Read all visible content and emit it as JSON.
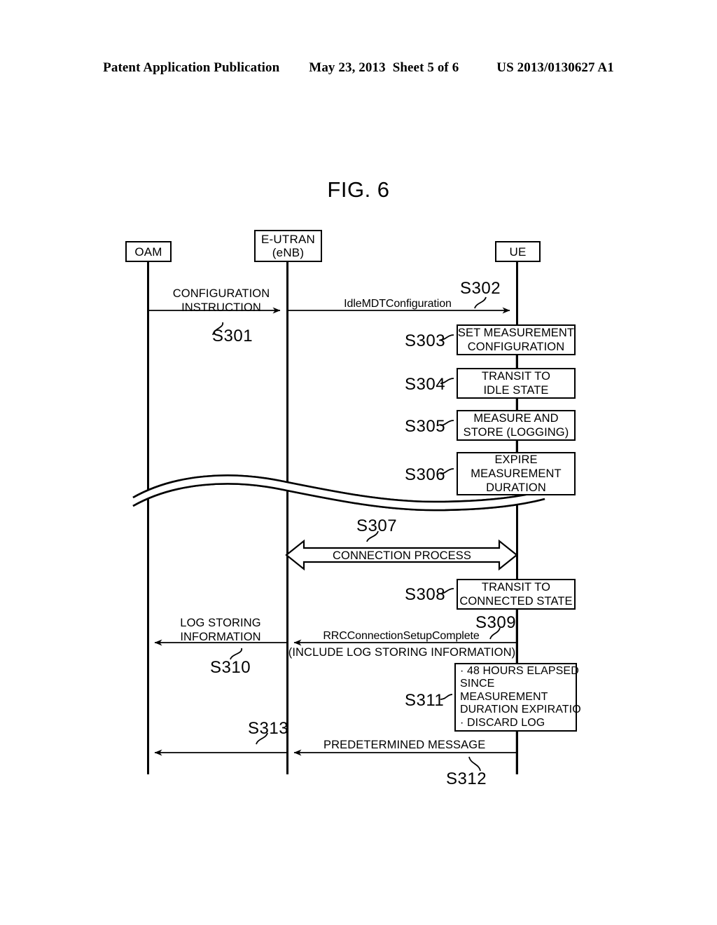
{
  "header": {
    "publication": "Patent Application Publication",
    "date": "May 23, 2013",
    "sheet": "Sheet 5 of 6",
    "patent_number": "US 2013/0130627 A1"
  },
  "figure": {
    "title": "FIG. 6"
  },
  "participants": [
    {
      "id": "oam",
      "label": "OAM"
    },
    {
      "id": "enb",
      "label_line1": "E-UTRAN",
      "label_line2": "(eNB)"
    },
    {
      "id": "ue",
      "label": "UE"
    }
  ],
  "messages": [
    {
      "step": "S301",
      "from": "oam",
      "to": "enb",
      "label_line1": "CONFIGURATION",
      "label_line2": "INSTRUCTION",
      "direction": "right"
    },
    {
      "step": "S302",
      "from": "enb",
      "to": "ue",
      "label_line1": "IdleMDTConfiguration",
      "direction": "right"
    },
    {
      "step": "S307",
      "from": "enb",
      "to": "ue",
      "label_line1": "CONNECTION PROCESS",
      "direction": "bidirectional"
    },
    {
      "step": "S309",
      "from": "ue",
      "to": "enb",
      "label_line1": "RRCConnectionSetupComplete",
      "label_line2": "(INCLUDE LOG STORING INFORMATION)",
      "direction": "left"
    },
    {
      "step": "S310",
      "from": "enb",
      "to": "oam",
      "label_line1": "LOG STORING",
      "label_line2": "INFORMATION",
      "direction": "left"
    },
    {
      "step": "S312",
      "from": "ue",
      "to": "enb",
      "label_line1": "PREDETERMINED MESSAGE",
      "direction": "left"
    },
    {
      "step": "S313",
      "from": "enb",
      "to": "oam",
      "label_line1": "",
      "direction": "left"
    }
  ],
  "process_boxes": [
    {
      "step": "S303",
      "on": "ue",
      "lines": [
        "SET MEASUREMENT",
        "CONFIGURATION"
      ]
    },
    {
      "step": "S304",
      "on": "ue",
      "lines": [
        "TRANSIT TO",
        "IDLE STATE"
      ]
    },
    {
      "step": "S305",
      "on": "ue",
      "lines": [
        "MEASURE AND",
        "STORE (LOGGING)"
      ]
    },
    {
      "step": "S306",
      "on": "ue",
      "lines": [
        "EXPIRE",
        "MEASUREMENT",
        "DURATION"
      ]
    },
    {
      "step": "S308",
      "on": "ue",
      "lines": [
        "TRANSIT TO",
        "CONNECTED STATE"
      ]
    },
    {
      "step": "S311",
      "on": "ue",
      "lines": [
        "· 48 HOURS ELAPSED",
        "  SINCE",
        "  MEASUREMENT",
        "  DURATION EXPIRATIO",
        "· DISCARD LOG"
      ]
    }
  ],
  "break_marker": {
    "type": "wavy-line-break",
    "description": "double sinusoidal page break across all lifelines"
  },
  "colors": {
    "ink": "#000000",
    "background": "#ffffff"
  }
}
